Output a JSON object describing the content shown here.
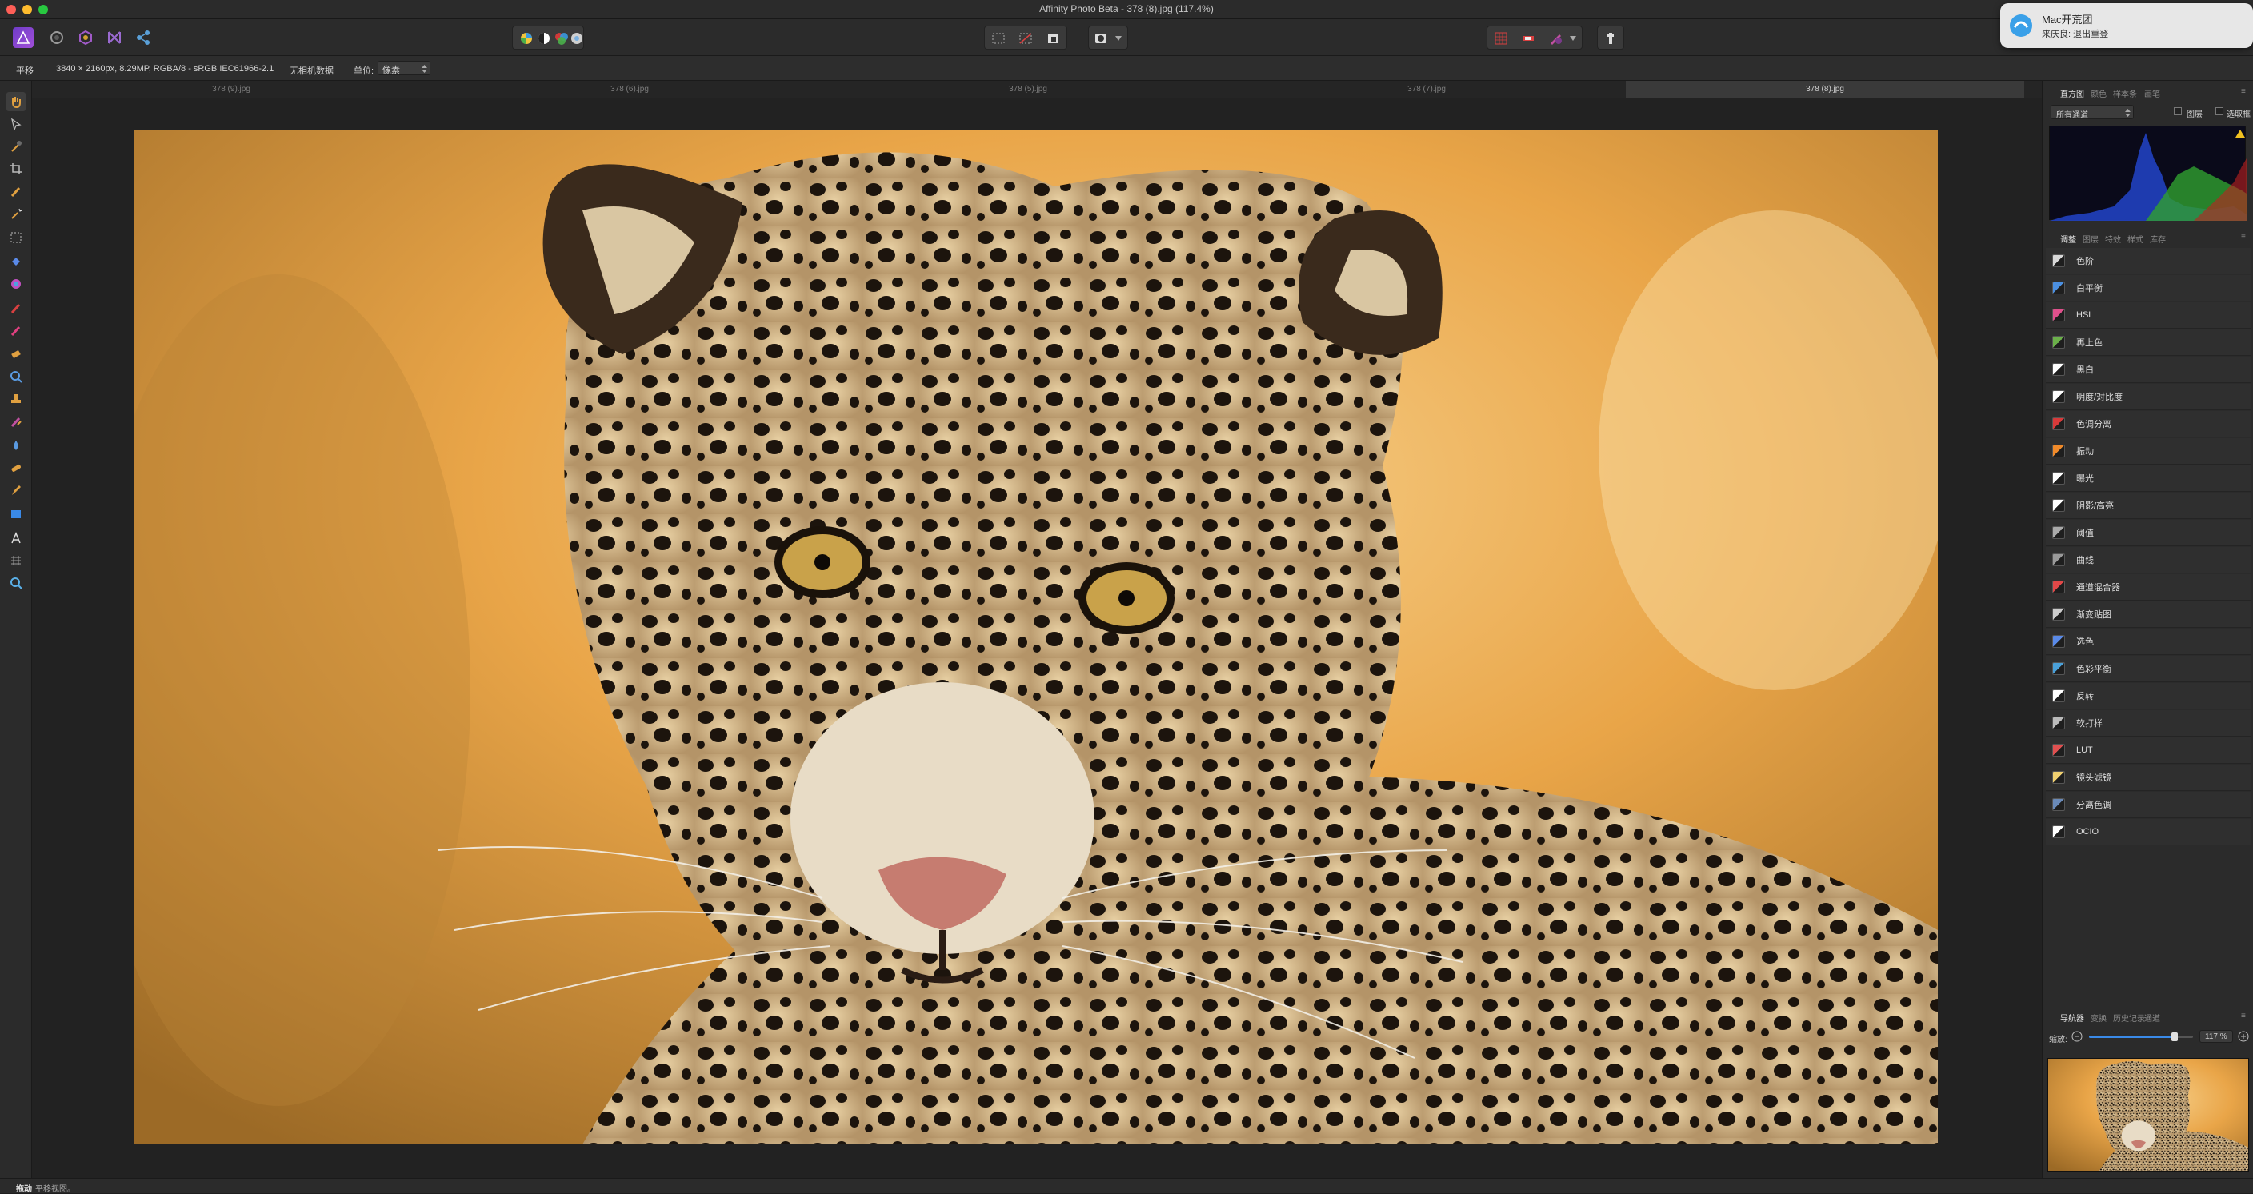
{
  "window": {
    "title": "Affinity Photo Beta - 378 (8).jpg (117.4%)"
  },
  "notification": {
    "app": "Mac开荒团",
    "message": "来庆良: 退出重登"
  },
  "context_bar": {
    "tool": "平移",
    "info": "3840 × 2160px, 8.29MP, RGBA/8 - sRGB IEC61966-2.1",
    "exif": "无相机数据",
    "units_label": "单位:",
    "units_value": "像素"
  },
  "doc_tabs": [
    "378 (9).jpg",
    "378 (6).jpg",
    "378 (5).jpg",
    "378 (7).jpg",
    "378 (8).jpg"
  ],
  "active_tab": "378 (8).jpg",
  "histogram": {
    "tabs": [
      "直方图",
      "颜色",
      "样本条",
      "画笔"
    ],
    "channel": "所有通道",
    "option1": "图层",
    "option2": "选取框"
  },
  "adjustments": {
    "tabs": [
      "调整",
      "图层",
      "特效",
      "样式",
      "库存"
    ],
    "items": [
      {
        "label": "色阶",
        "color": "#d8d8d8"
      },
      {
        "label": "白平衡",
        "color": "#4b8fe0"
      },
      {
        "label": "HSL",
        "color": "#e0508c"
      },
      {
        "label": "再上色",
        "color": "#6bb04a"
      },
      {
        "label": "黑白",
        "color": "#ffffff"
      },
      {
        "label": "明度/对比度",
        "color": "#ffffff"
      },
      {
        "label": "色调分离",
        "color": "#d83a3a"
      },
      {
        "label": "振动",
        "color": "#f08a2a"
      },
      {
        "label": "曝光",
        "color": "#ffffff"
      },
      {
        "label": "阴影/高亮",
        "color": "#ffffff"
      },
      {
        "label": "阈值",
        "color": "#aaaaaa"
      },
      {
        "label": "曲线",
        "color": "#9a9a9a"
      },
      {
        "label": "通道混合器",
        "color": "#e04848"
      },
      {
        "label": "渐变贴图",
        "color": "#cccccc"
      },
      {
        "label": "选色",
        "color": "#5a8ae8"
      },
      {
        "label": "色彩平衡",
        "color": "#4aa0d8"
      },
      {
        "label": "反转",
        "color": "#ffffff"
      },
      {
        "label": "软打样",
        "color": "#bbbbbb"
      },
      {
        "label": "LUT",
        "color": "#e05050"
      },
      {
        "label": "镜头滤镜",
        "color": "#f0d070"
      },
      {
        "label": "分离色调",
        "color": "#6a8ab8"
      },
      {
        "label": "OCIO",
        "color": "#ffffff"
      }
    ]
  },
  "navigator": {
    "tabs": [
      "导航器",
      "变换",
      "历史记录",
      "通道"
    ],
    "zoom_label": "缩放:",
    "zoom_value": "117 %",
    "zoom_fraction": 0.82
  },
  "status": {
    "mode": "拖动",
    "hint": "平移视图。"
  }
}
